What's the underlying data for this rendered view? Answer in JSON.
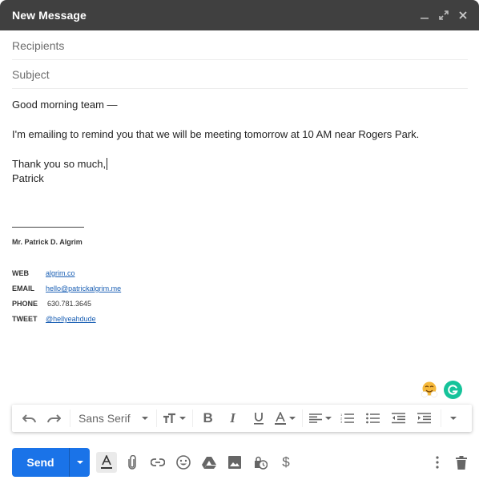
{
  "window": {
    "title": "New Message",
    "controls": [
      "minimize-icon",
      "expand-icon",
      "close-icon"
    ]
  },
  "fields": {
    "recipients_placeholder": "Recipients",
    "subject_placeholder": "Subject"
  },
  "body": {
    "greeting": "Good morning team —",
    "message": "I'm emailing to remind you that we will be meeting tomorrow at 10 AM near Rogers Park.",
    "closing": "Thank you so much,",
    "signoff": "Patrick"
  },
  "signature": {
    "name": "Mr. Patrick D. Algrim",
    "rows": [
      {
        "label": "WEB",
        "value": "algrim.co",
        "link": true
      },
      {
        "label": "EMAIL",
        "value": "hello@patrickalgrim.me",
        "link": true
      },
      {
        "label": "PHONE",
        "value": "630.781.3645",
        "link": false
      },
      {
        "label": "TWEET",
        "value": "@hellyeahdude",
        "link": true
      }
    ]
  },
  "formatting_toolbar": {
    "font": "Sans Serif",
    "buttons": [
      "undo-icon",
      "redo-icon",
      "font-family",
      "text-size-icon",
      "bold-icon",
      "italic-icon",
      "underline-icon",
      "text-color-icon",
      "align-icon",
      "numbered-list-icon",
      "bulleted-list-icon",
      "indent-less-icon",
      "indent-more-icon",
      "more-formatting-icon"
    ]
  },
  "bottom_toolbar": {
    "send_label": "Send",
    "icons": [
      "formatting-options-icon",
      "attach-icon",
      "link-icon",
      "emoji-icon",
      "drive-icon",
      "photo-icon",
      "confidential-mode-icon",
      "money-icon",
      "more-options-icon",
      "discard-icon"
    ]
  },
  "colors": {
    "titlebar": "#404040",
    "send": "#1a73e8",
    "grammarly": "#15c39a",
    "link": "#1a5fb4"
  }
}
